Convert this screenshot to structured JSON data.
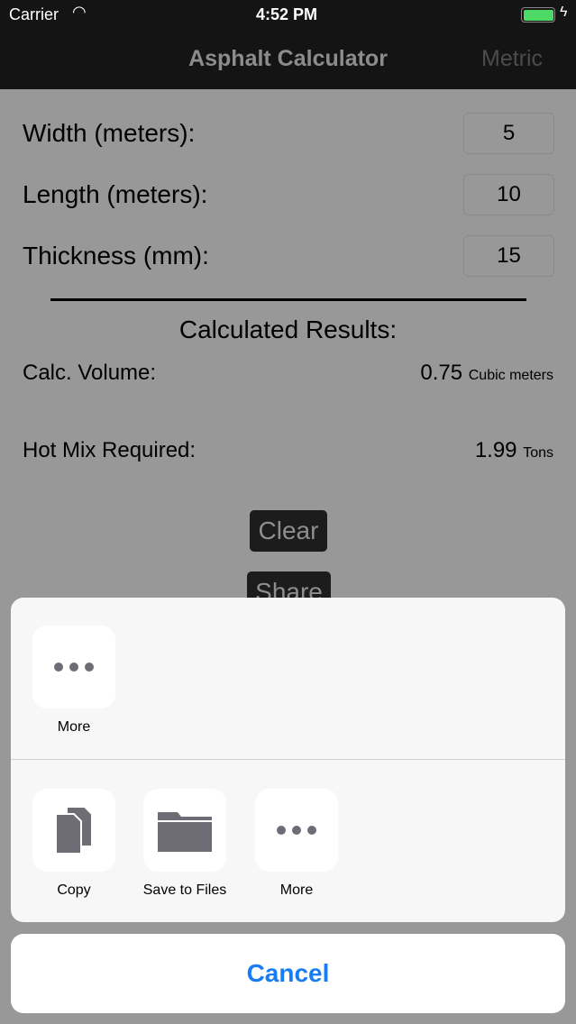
{
  "status": {
    "carrier": "Carrier",
    "time": "4:52 PM"
  },
  "nav": {
    "title": "Asphalt Calculator",
    "right": "Metric"
  },
  "form": {
    "fields": [
      {
        "label": "Width (meters):",
        "value": "5"
      },
      {
        "label": "Length (meters):",
        "value": "10"
      },
      {
        "label": "Thickness (mm):",
        "value": "15"
      }
    ]
  },
  "results": {
    "heading": "Calculated Results:",
    "volume_label": "Calc. Volume:",
    "volume_value": "0.75",
    "volume_unit": "Cubic meters",
    "hotmix_label": "Hot Mix Required:",
    "hotmix_value": "1.99",
    "hotmix_unit": "Tons"
  },
  "buttons": {
    "clear": "Clear",
    "share": "Share"
  },
  "sheet": {
    "row1": [
      {
        "label": "More",
        "icon": "more-icon"
      }
    ],
    "row2": [
      {
        "label": "Copy",
        "icon": "copy-icon"
      },
      {
        "label": "Save to Files",
        "icon": "folder-icon"
      },
      {
        "label": "More",
        "icon": "more-icon"
      }
    ],
    "cancel": "Cancel"
  },
  "colors": {
    "accent": "#1a7cf5",
    "battery": "#4cd964"
  }
}
